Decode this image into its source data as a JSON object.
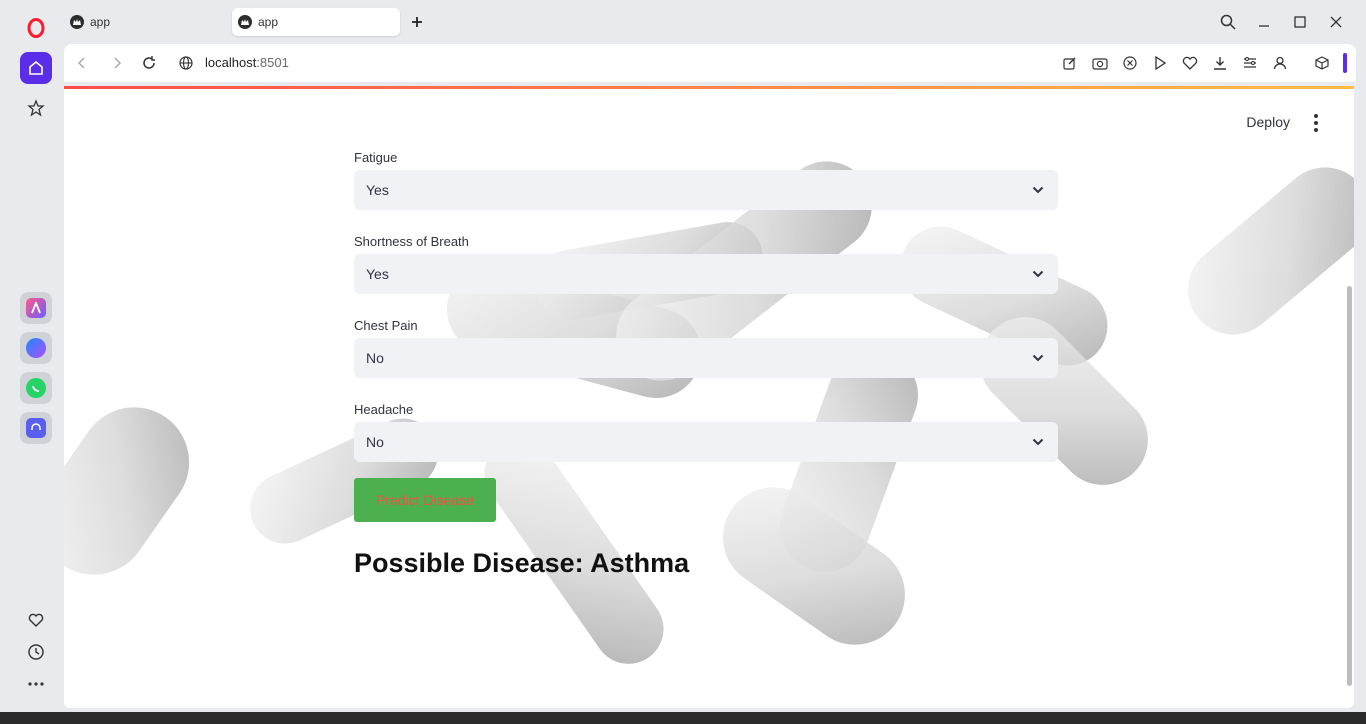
{
  "browser": {
    "tabs": [
      {
        "label": "app",
        "active": false
      },
      {
        "label": "app",
        "active": true
      }
    ],
    "url_host": "localhost",
    "url_port": ":8501"
  },
  "app": {
    "deploy_label": "Deploy",
    "fields": [
      {
        "label": "Fatigue",
        "value": "Yes"
      },
      {
        "label": "Shortness of Breath",
        "value": "Yes"
      },
      {
        "label": "Chest Pain",
        "value": "No"
      },
      {
        "label": "Headache",
        "value": "No"
      }
    ],
    "predict_label": "Predict Disease",
    "result": "Possible Disease: Asthma"
  },
  "colors": {
    "button_bg": "#4caf50",
    "button_text": "#ff4b4b",
    "select_bg": "#f0f2f6"
  },
  "icons": {
    "sidebar": [
      "opera-logo-icon",
      "home-icon",
      "star-icon",
      "aria-icon",
      "messenger-icon",
      "whatsapp-icon",
      "music-icon",
      "heart-icon",
      "history-icon",
      "more-icon"
    ],
    "toolbar": [
      "back-icon",
      "forward-icon",
      "reload-icon",
      "globe-icon",
      "edit-icon",
      "camera-icon",
      "shield-icon",
      "play-icon",
      "heart-icon",
      "download-icon",
      "easy-setup-icon",
      "profile-icon",
      "extensions-icon"
    ]
  }
}
